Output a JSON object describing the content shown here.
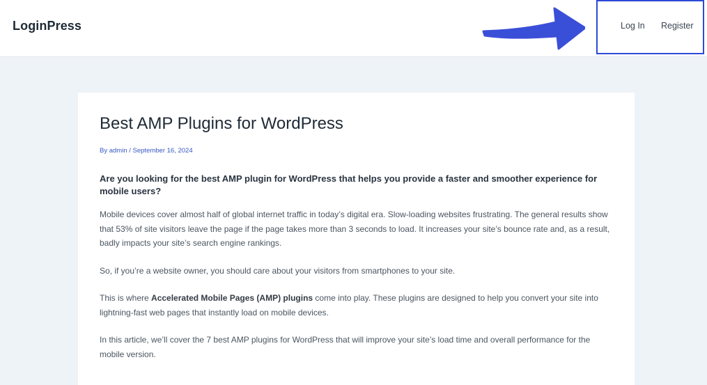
{
  "header": {
    "site_title": "LoginPress",
    "nav": {
      "login_label": "Log In",
      "register_label": "Register"
    },
    "highlight_color": "#2e49d6",
    "arrow_color": "#3a4fd8"
  },
  "article": {
    "title": "Best AMP Plugins for WordPress",
    "meta": {
      "by_prefix": "By ",
      "author": "admin",
      "separator": " / ",
      "date": "September 16, 2024"
    },
    "lead": "Are you looking for the best AMP plugin for WordPress that helps you provide a faster and smoother experience for mobile users?",
    "para1": "Mobile devices cover almost half of global internet traffic in today’s digital era. Slow-loading websites frustrating. The general results show that 53% of site visitors leave the page if the page takes more than 3 seconds to load. It increases your site’s bounce rate and, as a result, badly impacts your site’s search engine rankings.",
    "para2": "So, if you’re a website owner, you should care about your visitors from smartphones to your site.",
    "para3": {
      "before": "This is where ",
      "bold": "Accelerated Mobile Pages (AMP) plugins",
      "after": " come into play. These plugins are designed to help you convert your site into lightning-fast web pages that instantly load on mobile devices."
    },
    "para4": "In this article, we’ll cover the 7 best AMP plugins for WordPress that will improve your site’s load time and overall performance for the mobile version."
  }
}
